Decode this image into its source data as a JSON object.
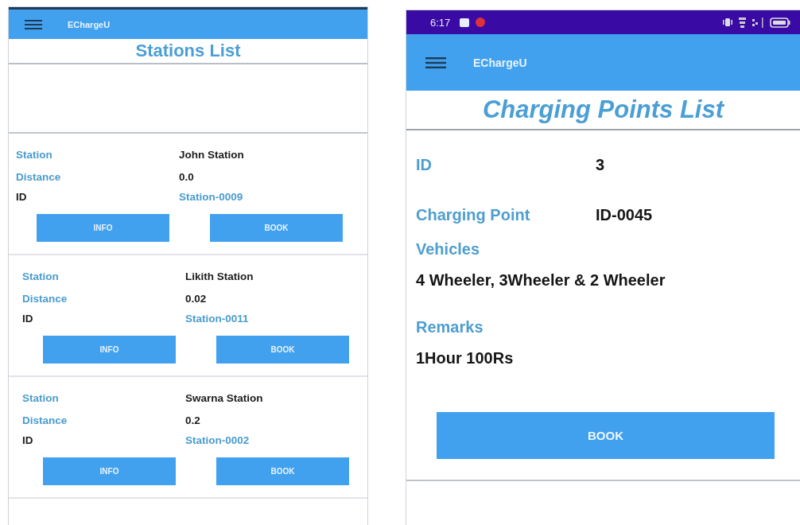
{
  "left_screen": {
    "app_bar": {
      "title": "EChargeU"
    },
    "heading": "Stations List",
    "stations": [
      {
        "rows": [
          {
            "kind": "name",
            "label": "Station",
            "value": "John Station"
          },
          {
            "kind": "distance",
            "label": "Distance",
            "value": "0.0"
          },
          {
            "kind": "id",
            "label": "ID",
            "value": "Station-0009"
          }
        ],
        "buttons": [
          "INFO",
          "BOOK"
        ]
      },
      {
        "rows": [
          {
            "kind": "name",
            "label": "Station",
            "value": "Likith Station"
          },
          {
            "kind": "distance",
            "label": "Distance",
            "value": "0.02"
          },
          {
            "kind": "id",
            "label": "ID",
            "value": "Station-0011"
          }
        ],
        "buttons": [
          "INFO",
          "BOOK"
        ]
      },
      {
        "rows": [
          {
            "kind": "name",
            "label": "Station",
            "value": "Swarna Station"
          },
          {
            "kind": "distance",
            "label": "Distance",
            "value": "0.2"
          },
          {
            "kind": "id",
            "label": "ID",
            "value": "Station-0002"
          }
        ],
        "buttons": [
          "INFO",
          "BOOK"
        ]
      }
    ]
  },
  "right_screen": {
    "status_bar": {
      "time": "6:17"
    },
    "app_bar": {
      "title": "EChargeU"
    },
    "heading": "Charging Points List",
    "fields": [
      {
        "kind": "inline",
        "label": "ID",
        "value": "3"
      },
      {
        "kind": "inline",
        "label": "Charging Point",
        "value": "ID-0045"
      },
      {
        "kind": "stacked",
        "label": "Vehicles",
        "value": "4 Wheeler, 3Wheeler & 2 Wheeler"
      },
      {
        "kind": "stacked",
        "label": "Remarks",
        "value": "1Hour 100Rs"
      }
    ],
    "button": "BOOK"
  }
}
